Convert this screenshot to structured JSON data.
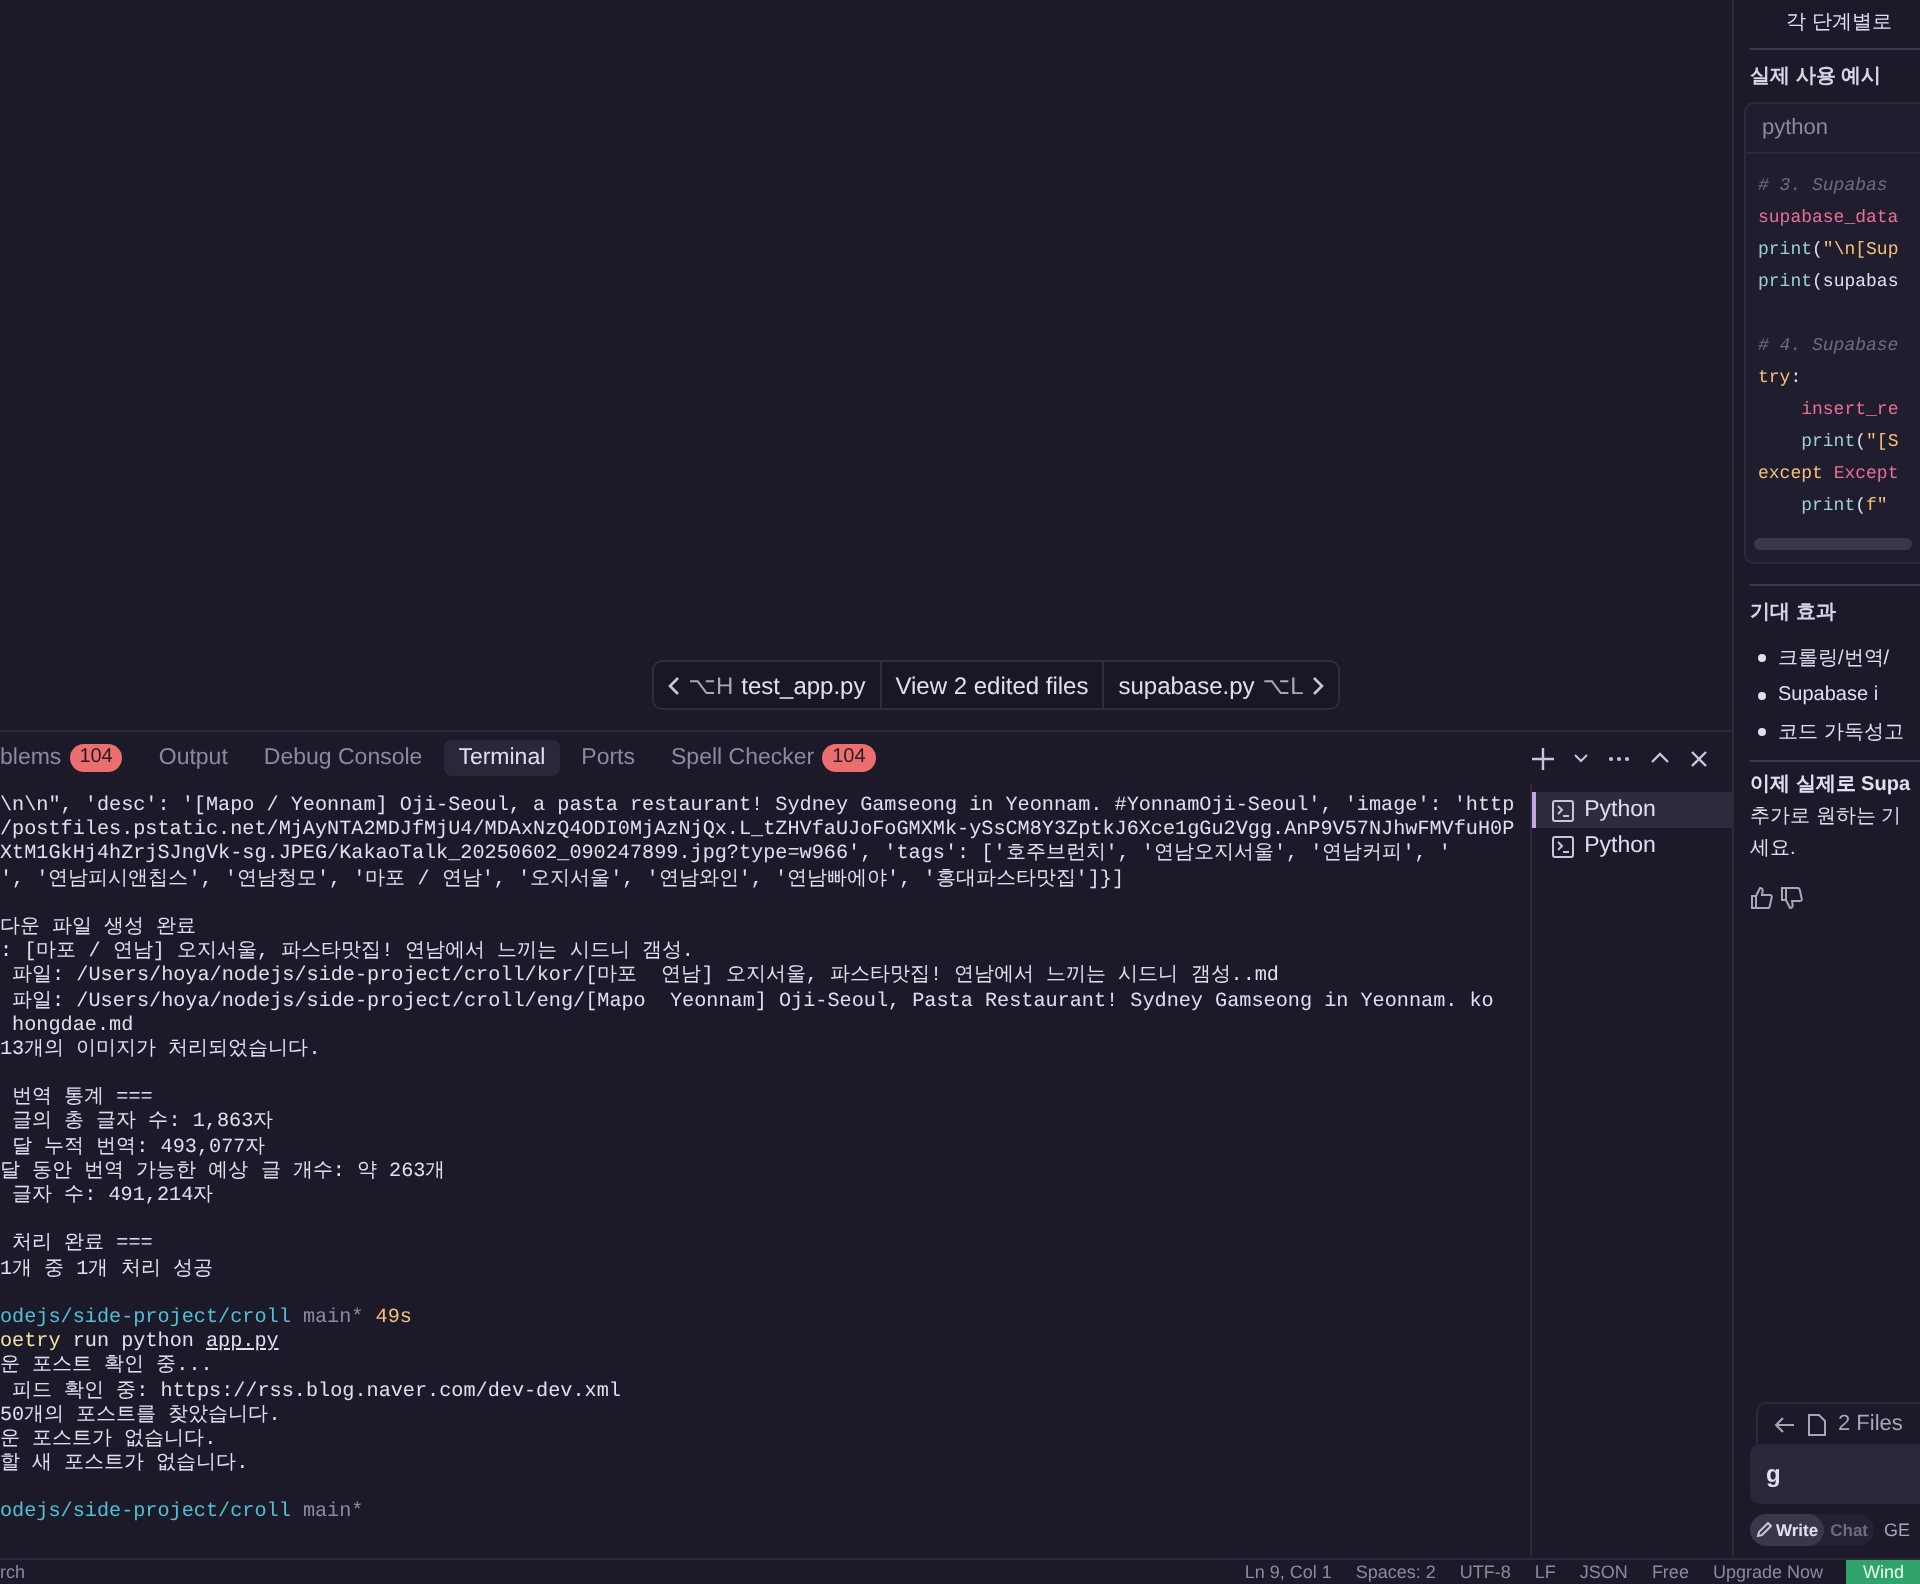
{
  "editor_nav": {
    "prev_shortcut": "⌥H",
    "prev_file": "test_app.py",
    "middle": "View 2 edited files",
    "next_file": "supabase.py",
    "next_shortcut": "⌥L"
  },
  "panel_tabs": [
    {
      "label": "blems",
      "count": "104",
      "selected": false
    },
    {
      "label": "Output",
      "selected": false
    },
    {
      "label": "Debug Console",
      "selected": false
    },
    {
      "label": "Terminal",
      "selected": true
    },
    {
      "label": "Ports",
      "selected": false
    },
    {
      "label": "Spell Checker",
      "count": "104",
      "selected": false
    }
  ],
  "terminal_lines": [
    {
      "kind": "output",
      "text": "\\n\\n\", 'desc': '[Mapo / Yeonnam] Oji-Seoul, a pasta restaurant! Sydney Gamseong in Yeonnam. #YonnamOji-Seoul', 'image': 'http"
    },
    {
      "kind": "output",
      "text": "/postfiles.pstatic.net/MjAyNTA2MDJfMjU4/MDAxNzQ4ODI0MjAzNjQx.L_tZHVfaUJoFoGMXMk-ySsCM8Y3ZptkJ6Xce1gGu2Vgg.AnP9V57NJhwFMVfuH0P"
    },
    {
      "kind": "output",
      "text": "XtM1GkHj4hZrjSJngVk-sg.JPEG/KakaoTalk_20250602_090247899.jpg?type=w966', 'tags': ['호주브런치', '연남오지서울', '연남커피', '"
    },
    {
      "kind": "output",
      "text": "', '연남피시앤칩스', '연남청모', '마포 / 연남', '오지서울', '연남와인', '연남빠에야', '홍대파스타맛집']}]"
    },
    {
      "kind": "blank"
    },
    {
      "kind": "output",
      "text": "다운 파일 생성 완료"
    },
    {
      "kind": "output",
      "text": ": [마포 / 연남] 오지서울, 파스타맛집! 연남에서 느끼는 시드니 갬성."
    },
    {
      "kind": "output",
      "text": " 파일: /Users/hoya/nodejs/side-project/croll/kor/[마포  연남] 오지서울, 파스타맛집! 연남에서 느끼는 시드니 갬성..md"
    },
    {
      "kind": "output",
      "text": " 파일: /Users/hoya/nodejs/side-project/croll/eng/[Mapo  Yeonnam] Oji-Seoul, Pasta Restaurant! Sydney Gamseong in Yeonnam. ko"
    },
    {
      "kind": "output",
      "text": " hongdae.md"
    },
    {
      "kind": "output",
      "text": "13개의 이미지가 처리되었습니다."
    },
    {
      "kind": "blank"
    },
    {
      "kind": "output",
      "text": " 번역 통계 ==="
    },
    {
      "kind": "output",
      "text": " 글의 총 글자 수: 1,863자"
    },
    {
      "kind": "output",
      "text": " 달 누적 번역: 493,077자"
    },
    {
      "kind": "output",
      "text": "달 동안 번역 가능한 예상 글 개수: 약 263개"
    },
    {
      "kind": "output",
      "text": " 글자 수: 491,214자"
    },
    {
      "kind": "blank"
    },
    {
      "kind": "output",
      "text": " 처리 완료 ==="
    },
    {
      "kind": "output",
      "text": "1개 중 1개 처리 성공"
    },
    {
      "kind": "blank"
    },
    {
      "kind": "prompt",
      "path": "odejs/side-project/croll",
      "branch": "main*",
      "time": "49s"
    },
    {
      "kind": "command",
      "program": "oetry",
      "args": "run python",
      "file": "app.py"
    },
    {
      "kind": "output",
      "text": "운 포스트 확인 중..."
    },
    {
      "kind": "output",
      "text": " 피드 확인 중: https://rss.blog.naver.com/dev-dev.xml"
    },
    {
      "kind": "output",
      "text": "50개의 포스트를 찾았습니다."
    },
    {
      "kind": "output",
      "text": "운 포스트가 없습니다."
    },
    {
      "kind": "output",
      "text": "할 새 포스트가 없습니다."
    },
    {
      "kind": "blank"
    },
    {
      "kind": "prompt",
      "path": "odejs/side-project/croll",
      "branch": "main*"
    }
  ],
  "terminal_list": [
    {
      "label": "Python",
      "selected": true
    },
    {
      "label": "Python",
      "selected": false
    }
  ],
  "chat": {
    "top_line": "각 단계별로",
    "heading": "실제 사용 예시",
    "code_language": "python",
    "code_groups": [
      [
        [
          {
            "kind": "comment",
            "text": "# 3. Supabas"
          }
        ],
        [
          {
            "kind": "variable",
            "text": "supabase_data"
          }
        ],
        [
          {
            "kind": "function",
            "text": "print"
          },
          {
            "kind": "plain",
            "text": "("
          },
          {
            "kind": "string",
            "text": "\"\\n[Sup"
          }
        ],
        [
          {
            "kind": "function",
            "text": "print"
          },
          {
            "kind": "plain",
            "text": "(supabas"
          }
        ]
      ],
      [
        [
          {
            "kind": "comment",
            "text": "# 4. Supabase"
          }
        ],
        [
          {
            "kind": "keyword",
            "text": "try"
          },
          {
            "kind": "plain",
            "text": ":"
          }
        ],
        [
          {
            "kind": "indent"
          },
          {
            "kind": "variable",
            "text": "insert_re"
          }
        ],
        [
          {
            "kind": "indent"
          },
          {
            "kind": "function",
            "text": "print"
          },
          {
            "kind": "plain",
            "text": "("
          },
          {
            "kind": "string",
            "text": "\"[S"
          }
        ],
        [
          {
            "kind": "keyword",
            "text": "except"
          },
          {
            "kind": "variable",
            "text": "Except",
            "space_before": true
          }
        ],
        [
          {
            "kind": "indent"
          },
          {
            "kind": "function",
            "text": "print"
          },
          {
            "kind": "plain",
            "text": "("
          },
          {
            "kind": "string",
            "text": "f\""
          }
        ]
      ]
    ],
    "effects_heading": "기대 효과",
    "effects": [
      "크롤링/번역/",
      "Supabase i",
      "코드 가독성고"
    ],
    "closing_lines": [
      "이제 실제로 Supa",
      "추가로 원하는 기",
      "세요."
    ],
    "files_label": "2 Files",
    "input_value": "g",
    "modes": [
      {
        "label": "Write",
        "selected": true
      },
      {
        "label": "Chat",
        "selected": false
      }
    ],
    "model_label": "GE"
  },
  "status_bar": {
    "left": "rch",
    "items": [
      "Ln 9, Col 1",
      "Spaces: 2",
      "UTF-8",
      "LF",
      "JSON",
      "Free",
      "Upgrade Now"
    ],
    "button": "Wind"
  }
}
